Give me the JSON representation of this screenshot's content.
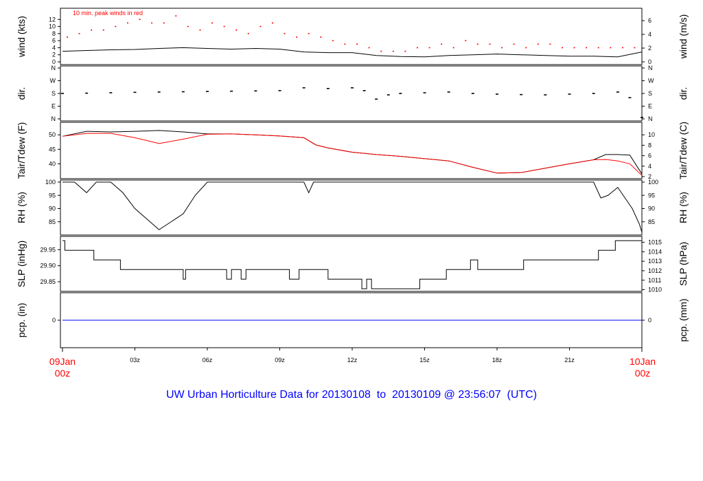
{
  "chart_data": [
    {
      "type": "line",
      "panel": "wind",
      "ylabel_left": "wind (kts)",
      "ylabel_right": "wind (m/s)",
      "annotation": "10 min. peak winds in red",
      "ylim": [
        0,
        14
      ],
      "ticks_left": [
        "0",
        "2",
        "4",
        "6",
        "8",
        "10",
        "12"
      ],
      "ticks_right": [
        "0",
        "2",
        "4",
        "6"
      ],
      "series": [
        {
          "color": "#000000",
          "x": [
            0,
            1,
            2,
            3,
            4,
            5,
            6,
            7,
            8,
            9,
            10,
            11,
            12,
            13,
            14,
            15,
            16,
            17,
            18,
            19,
            20,
            21,
            22,
            23,
            24
          ],
          "values": [
            3.0,
            3.2,
            3.4,
            3.5,
            3.8,
            4.0,
            3.8,
            3.6,
            3.8,
            3.6,
            2.8,
            2.6,
            2.6,
            1.8,
            1.5,
            1.4,
            1.8,
            2.0,
            2.2,
            2.0,
            1.8,
            1.6,
            1.6,
            1.4,
            2.8
          ]
        },
        {
          "color": "#ff0000",
          "x": [
            0.2,
            0.7,
            1.2,
            1.7,
            2.2,
            2.7,
            3.2,
            3.7,
            4.2,
            4.7,
            5.2,
            5.7,
            6.2,
            6.7,
            7.2,
            7.7,
            8.2,
            8.7,
            9.2,
            9.7,
            10.2,
            10.7,
            11.2,
            11.7,
            12.2,
            12.7,
            13.2,
            13.7,
            14.2,
            14.7,
            15.2,
            15.7,
            16.2,
            16.7,
            17.2,
            17.7,
            18.2,
            18.7,
            19.2,
            19.7,
            20.2,
            20.7,
            21.2,
            21.7,
            22.2,
            22.7,
            23.2,
            23.7
          ],
          "values": [
            7,
            8,
            9,
            9,
            10,
            11,
            12,
            11,
            11,
            13,
            10,
            9,
            11,
            10,
            9,
            8,
            10,
            11,
            8,
            7,
            8,
            7,
            6,
            5,
            5,
            4,
            3,
            3,
            3,
            4,
            4,
            5,
            4,
            6,
            5,
            5,
            4,
            5,
            4,
            5,
            5,
            4,
            4,
            4,
            4,
            4,
            4,
            4
          ]
        }
      ]
    },
    {
      "type": "scatter",
      "panel": "dir",
      "ylabel_left": "dir.",
      "ylabel_right": "dir.",
      "ylim": [
        0,
        360
      ],
      "ticks_left": [
        "N",
        "E",
        "S",
        "W",
        "N"
      ],
      "ticks_right": [
        "N",
        "E",
        "S",
        "W",
        "N"
      ],
      "series": [
        {
          "color": "#000000",
          "x": [
            0,
            1,
            2,
            3,
            4,
            5,
            6,
            7,
            8,
            9,
            10,
            11,
            12,
            12.5,
            13,
            13.5,
            14,
            15,
            16,
            17,
            18,
            19,
            20,
            21,
            22,
            23,
            23.5,
            24
          ],
          "values": [
            180,
            182,
            185,
            188,
            190,
            192,
            194,
            196,
            198,
            200,
            220,
            215,
            220,
            200,
            140,
            170,
            180,
            185,
            190,
            180,
            175,
            172,
            170,
            175,
            180,
            190,
            150,
            10
          ]
        }
      ]
    },
    {
      "type": "line",
      "panel": "temperature",
      "ylabel_left": "Tair/Tdew (F)",
      "ylabel_right": "Tair/Tdew (C)",
      "ylim": [
        35.6,
        53.6
      ],
      "ticks_left": [
        "40",
        "45",
        "50"
      ],
      "ticks_right": [
        "2",
        "4",
        "6",
        "8",
        "10"
      ],
      "series": [
        {
          "color": "#000000",
          "x": [
            0,
            1,
            2,
            3,
            4,
            5,
            6,
            7,
            8,
            9,
            10,
            10.5,
            11,
            12,
            13,
            14,
            15,
            16,
            17,
            18,
            19,
            20,
            21,
            22,
            22.5,
            23,
            23.5,
            24
          ],
          "values": [
            49.5,
            51.2,
            51.0,
            51.2,
            51.5,
            51.0,
            50.3,
            50.3,
            50.0,
            49.6,
            49.0,
            46.5,
            45.5,
            44.0,
            43.2,
            42.6,
            41.8,
            41.0,
            38.8,
            36.8,
            37.0,
            38.5,
            40.0,
            41.4,
            43.2,
            43.2,
            43.0,
            36.5
          ]
        },
        {
          "color": "#ff0000",
          "x": [
            0,
            1,
            2,
            3,
            4,
            5,
            6,
            7,
            8,
            9,
            10,
            10.5,
            11,
            12,
            13,
            14,
            15,
            16,
            17,
            18,
            19,
            20,
            21,
            22,
            22.5,
            23,
            23.5,
            24
          ],
          "values": [
            49.5,
            50.5,
            50.5,
            49.0,
            47.0,
            48.5,
            50.2,
            50.3,
            50.0,
            49.6,
            49.0,
            46.5,
            45.5,
            44.0,
            43.2,
            42.6,
            41.8,
            41.0,
            38.8,
            36.8,
            37.0,
            38.5,
            40.0,
            41.4,
            41.5,
            41.0,
            40.0,
            36.0
          ]
        }
      ]
    },
    {
      "type": "line",
      "panel": "rh",
      "ylabel_left": "RH (%)",
      "ylabel_right": "RH (%)",
      "ylim": [
        80,
        100
      ],
      "ticks_left": [
        "85",
        "90",
        "95",
        "100"
      ],
      "ticks_right": [
        "85",
        "90",
        "95",
        "100"
      ],
      "series": [
        {
          "color": "#000000",
          "x": [
            0,
            0.5,
            1.0,
            1.4,
            1.7,
            2.0,
            2.5,
            3.0,
            3.5,
            4.0,
            4.5,
            5.0,
            5.5,
            6.0,
            6.5,
            7.0,
            8.0,
            9.0,
            10.0,
            10.2,
            10.4,
            10.6,
            11,
            12,
            13,
            14,
            15,
            16,
            17,
            18,
            19,
            20,
            21,
            22,
            22.3,
            22.6,
            23,
            23.3,
            23.6,
            23.9,
            24
          ],
          "values": [
            100,
            100,
            96,
            100,
            100,
            100,
            96,
            90,
            86,
            82,
            85,
            88,
            95,
            100,
            100,
            100,
            100,
            100,
            100,
            96,
            100,
            100,
            100,
            100,
            100,
            100,
            100,
            100,
            100,
            100,
            100,
            100,
            100,
            100,
            94,
            95,
            98,
            94,
            90,
            84,
            81
          ]
        }
      ]
    },
    {
      "type": "line",
      "panel": "slp",
      "ylabel_left": "SLP (inHg)",
      "ylabel_right": "SLP (hPa)",
      "ylim": [
        29.82,
        29.985
      ],
      "ticks_left": [
        "29.85",
        "29.90",
        "29.95"
      ],
      "ticks_right": [
        "1010",
        "1011",
        "1012",
        "1013",
        "1014",
        "1015"
      ],
      "series": [
        {
          "color": "#000000",
          "x": [
            0,
            0.1,
            1.3,
            2.4,
            5.0,
            5.1,
            6.8,
            7.0,
            7.4,
            7.6,
            8.5,
            9.4,
            9.8,
            11.0,
            12.4,
            12.6,
            12.8,
            14.8,
            15.9,
            16.9,
            17.2,
            19.1,
            19.2,
            22.2,
            22.9,
            24
          ],
          "values": [
            29.978,
            29.948,
            29.918,
            29.888,
            29.858,
            29.888,
            29.858,
            29.888,
            29.858,
            29.888,
            29.888,
            29.858,
            29.888,
            29.858,
            29.828,
            29.858,
            29.828,
            29.858,
            29.888,
            29.918,
            29.888,
            29.918,
            29.918,
            29.948,
            29.978,
            29.978
          ]
        }
      ]
    },
    {
      "type": "line",
      "panel": "pcp",
      "ylabel_left": "pcp. (in)",
      "ylabel_right": "pcp. (mm)",
      "ylim": [
        -1,
        1
      ],
      "ticks_left": [
        "0"
      ],
      "ticks_right": [
        "0"
      ],
      "series": [
        {
          "color": "#0000ff",
          "x": [
            0,
            24
          ],
          "values": [
            0,
            0
          ]
        }
      ]
    }
  ],
  "x_axis": {
    "range_hours": [
      0,
      24
    ],
    "tick_hours": [
      3,
      6,
      9,
      12,
      15,
      18,
      21
    ],
    "tick_labels": [
      "03z",
      "06z",
      "09z",
      "12z",
      "15z",
      "18z",
      "21z"
    ],
    "start_label_top": "09Jan",
    "start_label_bottom": "00z",
    "end_label_top": "10Jan",
    "end_label_bottom": "00z"
  },
  "title": "UW Urban Horticulture Data for 20130108  to  20130109 @ 23:56:07  (UTC)",
  "colors": {
    "primary": "#000000",
    "peak": "#ff0000",
    "dewpoint": "#ff0000",
    "precip": "#0000ff",
    "title": "#0000ff"
  }
}
